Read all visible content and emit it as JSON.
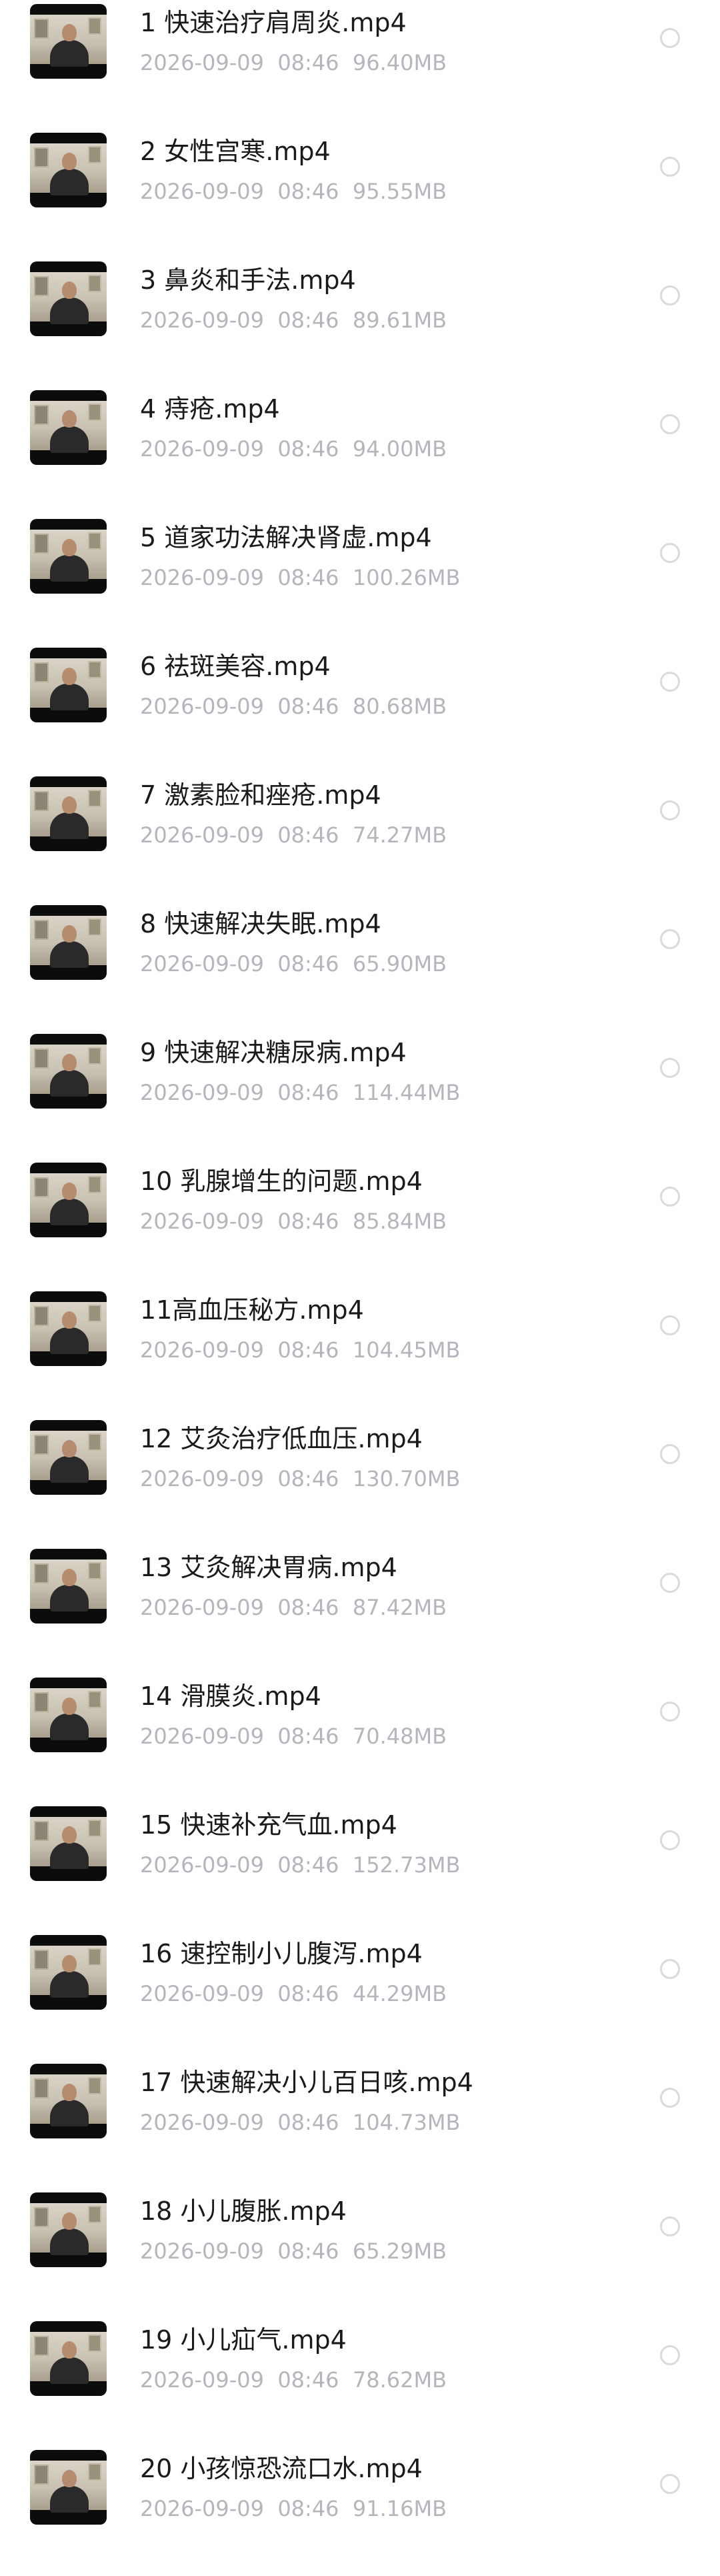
{
  "files": [
    {
      "title": "1  快速治疗肩周炎.mp4",
      "date": "2026-09-09",
      "time": "08:46",
      "size": "96.40MB"
    },
    {
      "title": "2  女性宫寒.mp4",
      "date": "2026-09-09",
      "time": "08:46",
      "size": "95.55MB"
    },
    {
      "title": "3  鼻炎和手法.mp4",
      "date": "2026-09-09",
      "time": "08:46",
      "size": "89.61MB"
    },
    {
      "title": "4  痔疮.mp4",
      "date": "2026-09-09",
      "time": "08:46",
      "size": "94.00MB"
    },
    {
      "title": "5  道家功法解决肾虚.mp4",
      "date": "2026-09-09",
      "time": "08:46",
      "size": "100.26MB"
    },
    {
      "title": "6  祛斑美容.mp4",
      "date": "2026-09-09",
      "time": "08:46",
      "size": "80.68MB"
    },
    {
      "title": "7  激素脸和痤疮.mp4",
      "date": "2026-09-09",
      "time": "08:46",
      "size": "74.27MB"
    },
    {
      "title": "8  快速解决失眠.mp4",
      "date": "2026-09-09",
      "time": "08:46",
      "size": "65.90MB"
    },
    {
      "title": "9  快速解决糖尿病.mp4",
      "date": "2026-09-09",
      "time": "08:46",
      "size": "114.44MB"
    },
    {
      "title": "10  乳腺增生的问题.mp4",
      "date": "2026-09-09",
      "time": "08:46",
      "size": "85.84MB"
    },
    {
      "title": "11高血压秘方.mp4",
      "date": "2026-09-09",
      "time": "08:46",
      "size": "104.45MB"
    },
    {
      "title": "12  艾灸治疗低血压.mp4",
      "date": "2026-09-09",
      "time": "08:46",
      "size": "130.70MB"
    },
    {
      "title": "13  艾灸解决胃病.mp4",
      "date": "2026-09-09",
      "time": "08:46",
      "size": "87.42MB"
    },
    {
      "title": "14  滑膜炎.mp4",
      "date": "2026-09-09",
      "time": "08:46",
      "size": "70.48MB"
    },
    {
      "title": "15  快速补充气血.mp4",
      "date": "2026-09-09",
      "time": "08:46",
      "size": "152.73MB"
    },
    {
      "title": "16  速控制小儿腹泻.mp4",
      "date": "2026-09-09",
      "time": "08:46",
      "size": "44.29MB"
    },
    {
      "title": "17  快速解决小儿百日咳.mp4",
      "date": "2026-09-09",
      "time": "08:46",
      "size": "104.73MB"
    },
    {
      "title": "18  小儿腹胀.mp4",
      "date": "2026-09-09",
      "time": "08:46",
      "size": "65.29MB"
    },
    {
      "title": "19  小儿疝气.mp4",
      "date": "2026-09-09",
      "time": "08:46",
      "size": "78.62MB"
    },
    {
      "title": "20  小孩惊恐流口水.mp4",
      "date": "2026-09-09",
      "time": "08:46",
      "size": "91.16MB"
    }
  ]
}
